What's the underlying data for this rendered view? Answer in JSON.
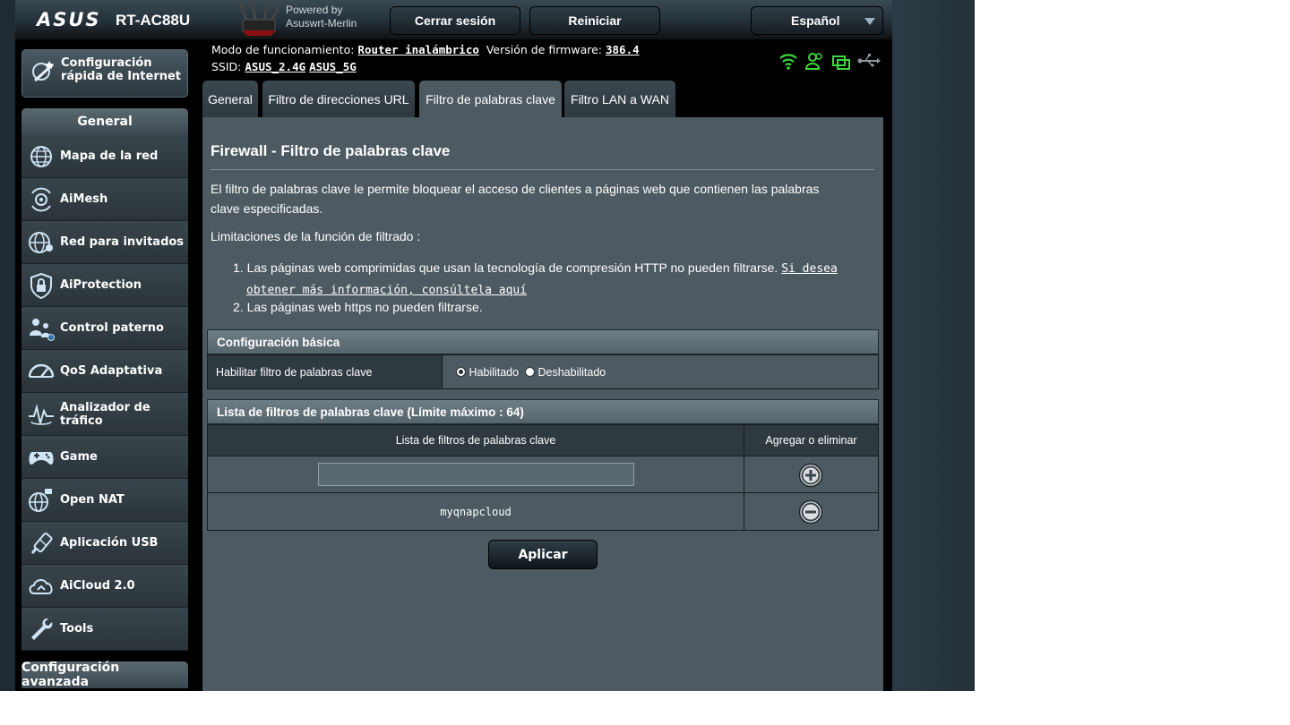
{
  "header": {
    "brand": "ASUS",
    "model": "RT-AC88U",
    "powered_line1": "Powered by",
    "powered_line2": "Asuswrt-Merlin",
    "logout_label": "Cerrar sesión",
    "reboot_label": "Reiniciar",
    "language": "Español"
  },
  "sidebar": {
    "quick_setup_line1": "Configuración",
    "quick_setup_line2": "rápida de Internet",
    "general_title": "General",
    "items": [
      {
        "label": "Mapa de la red",
        "icon": "network-map-icon"
      },
      {
        "label": "AiMesh",
        "icon": "aimesh-icon"
      },
      {
        "label": "Red para invitados",
        "icon": "guest-network-icon"
      },
      {
        "label": "AiProtection",
        "icon": "aiprotection-icon"
      },
      {
        "label": "Control paterno",
        "icon": "parental-control-icon"
      },
      {
        "label": "QoS Adaptativa",
        "icon": "qos-gauge-icon"
      },
      {
        "label": "Analizador de tráfico",
        "icon": "traffic-analyzer-icon"
      },
      {
        "label": "Game",
        "icon": "gamepad-icon"
      },
      {
        "label": "Open NAT",
        "icon": "open-nat-icon"
      },
      {
        "label": "Aplicación USB",
        "icon": "usb-app-icon"
      },
      {
        "label": "AiCloud 2.0",
        "icon": "aicloud-icon"
      },
      {
        "label": "Tools",
        "icon": "wrench-icon"
      }
    ],
    "advanced_title": "Configuración avanzada"
  },
  "info": {
    "mode_label": "Modo de funcionamiento:",
    "mode_value": "Router inalámbrico",
    "fw_label": "Versión de firmware:",
    "fw_value": "386.4",
    "ssid_label": "SSID:",
    "ssid_24": "ASUS_2.4G",
    "ssid_5": "ASUS_5G"
  },
  "status_icons": [
    "wifi-icon",
    "clients-icon",
    "devices-icon",
    "usb-icon"
  ],
  "tabs": [
    "General",
    "Filtro de direcciones URL",
    "Filtro de palabras clave",
    "Filtro LAN a WAN"
  ],
  "active_tab": 2,
  "main": {
    "title": "Firewall - Filtro de palabras clave",
    "description": "El filtro de palabras clave le permite bloquear el acceso de clientes a páginas web que contienen las palabras clave especificadas.",
    "limits_title": "Limitaciones de la función de filtrado :",
    "limit1_text": "1. Las páginas web comprimidas que usan la tecnología de compresión HTTP no pueden filtrarse. ",
    "limit1_link": "Si desea obtener más información, consúltela aquí",
    "limit2_text": "2. Las páginas web https no pueden filtrarse.",
    "basic_section": "Configuración básica",
    "enable_label": "Habilitar filtro de palabras clave",
    "enabled_option": "Habilitado",
    "disabled_option": "Deshabilitado",
    "enabled_selected": true,
    "list_section": "Lista de filtros de palabras clave (Límite máximo : 64)",
    "col_keyword": "Lista de filtros de palabras clave",
    "col_action": "Agregar o eliminar",
    "new_keyword_value": "",
    "entries": [
      "myqnapcloud"
    ],
    "apply_label": "Aplicar"
  }
}
